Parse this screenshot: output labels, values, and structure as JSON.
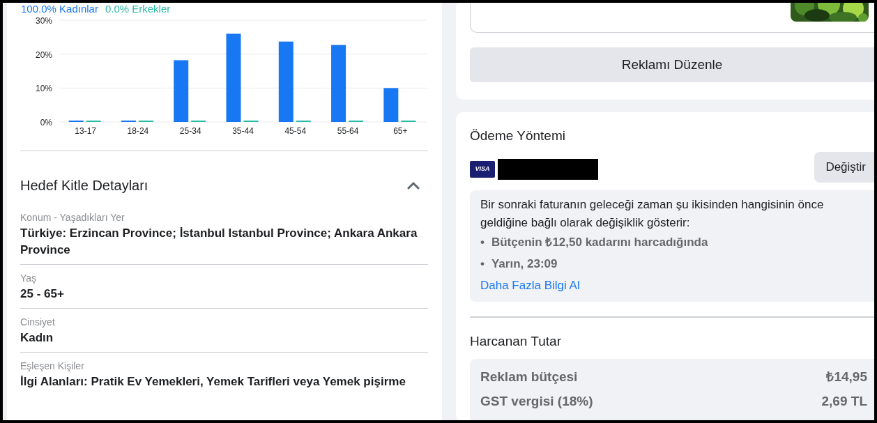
{
  "demographics": {
    "legend": [
      {
        "label": "100.0% Kadınlar",
        "color": "#1877f2"
      },
      {
        "label": "0.0% Erkekler",
        "color": "#2abba7"
      }
    ],
    "chart_data": {
      "type": "bar",
      "categories": [
        "13-17",
        "18-24",
        "25-34",
        "35-44",
        "45-54",
        "55-64",
        "65+"
      ],
      "series": [
        {
          "color": "#1877f2",
          "values": [
            0.3,
            0.3,
            18.2,
            26,
            23.7,
            22.7,
            10
          ]
        },
        {
          "color": "#2abba7",
          "values": [
            0,
            0,
            0,
            0,
            0,
            0,
            0
          ]
        }
      ],
      "ylim": [
        0,
        30
      ],
      "yticks": [
        {
          "value": 0,
          "label": "0%"
        },
        {
          "value": 10,
          "label": "10%"
        },
        {
          "value": 20,
          "label": "20%"
        },
        {
          "value": 30,
          "label": "30%"
        }
      ]
    }
  },
  "audience": {
    "title": "Hedef Kitle Detayları",
    "expanded": true,
    "fields": [
      {
        "label": "Konum - Yaşadıkları Yer",
        "value": "Türkiye: Erzincan Province; İstanbul Istanbul Province; Ankara Ankara Province"
      },
      {
        "label": "Yaş",
        "value": "25 - 65+"
      },
      {
        "label": "Cinsiyet",
        "value": "Kadın"
      },
      {
        "label": "Eşleşen Kişiler",
        "value": "İlgi Alanları: Pratik Ev Yemekleri, Yemek Tarifleri veya Yemek pişirme"
      }
    ]
  },
  "edit_button": "Reklamı Düzenle",
  "payment": {
    "title": "Ödeme Yöntemi",
    "card_brand": "VISA",
    "change_button": "Değiştir",
    "info": {
      "text": "Bir sonraki faturanın geleceği zaman şu ikisinden hangisinin önce geldiğine bağlı olarak değişiklik gösterir:",
      "bullets": [
        {
          "marker": "•",
          "text": "Bütçenin ₺12,50 kadarını harcadığında"
        },
        {
          "marker": "•",
          "text": "Yarın, 23:09"
        }
      ],
      "link": "Daha Fazla Bilgi Al"
    }
  },
  "spent": {
    "title": "Harcanan Tutar",
    "rows": [
      {
        "label": "Reklam bütçesi",
        "amount": "₺14,95"
      },
      {
        "label": "GST vergisi (18%)",
        "amount": "2,69 TL"
      }
    ]
  }
}
